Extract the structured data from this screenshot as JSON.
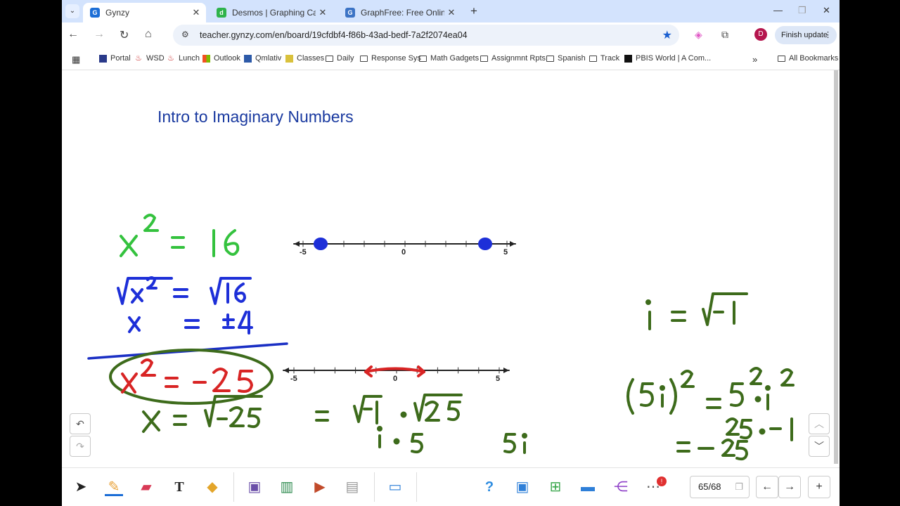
{
  "browser": {
    "tabs": [
      {
        "label": "Gynzy",
        "favicon": "gynzy-icon",
        "color": "#1c6ed6",
        "active": true
      },
      {
        "label": "Desmos | Graphing Calculato",
        "favicon": "desmos-icon",
        "color": "#2eb34b",
        "active": false
      },
      {
        "label": "GraphFree: Free Online Grap",
        "favicon": "graphfree-icon",
        "color": "#3b73c5",
        "active": false
      }
    ],
    "url": "teacher.gynzy.com/en/board/19cfdbf4-f86b-43ad-bedf-7a2f2074ea04",
    "profile_initial": "D",
    "finish_update_label": "Finish update",
    "bookmarks": [
      {
        "label": "Portal",
        "icon": "portal-icon"
      },
      {
        "label": "WSD",
        "icon": "flame-icon"
      },
      {
        "label": "Lunch",
        "icon": "flame-icon"
      },
      {
        "label": "Outlook",
        "icon": "windows-icon"
      },
      {
        "label": "Qmlativ",
        "icon": "qmlativ-icon"
      },
      {
        "label": "Classes",
        "icon": "classes-icon"
      },
      {
        "label": "Daily",
        "icon": "folder-icon"
      },
      {
        "label": "Response Sys",
        "icon": "folder-icon"
      },
      {
        "label": "Math Gadgets",
        "icon": "folder-icon"
      },
      {
        "label": "Assignmnt Rpts",
        "icon": "folder-icon"
      },
      {
        "label": "Spanish",
        "icon": "folder-icon"
      },
      {
        "label": "Track",
        "icon": "folder-icon"
      },
      {
        "label": "PBIS World | A Com...",
        "icon": "pbis-icon"
      }
    ],
    "all_bookmarks_label": "All Bookmarks"
  },
  "board": {
    "title": "Intro to Imaginary Numbers",
    "number_line_1": {
      "ticks": [
        "-5",
        "0",
        "5"
      ],
      "points": [
        -4,
        4
      ]
    },
    "number_line_2": {
      "ticks": [
        "-5",
        "0",
        "5"
      ]
    },
    "ink_colors": {
      "green": "#34c23e",
      "blue": "#1d2fd8",
      "red": "#d82424",
      "olive": "#3d6b1b",
      "navy": "#1a2fc4"
    }
  },
  "pager": {
    "label": "65/68"
  }
}
